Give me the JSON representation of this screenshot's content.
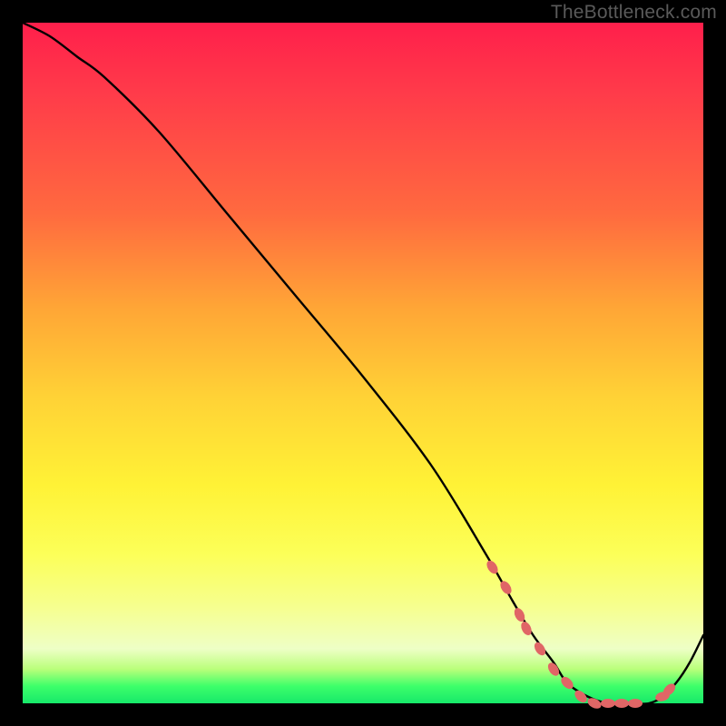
{
  "watermark": "TheBottleneck.com",
  "chart_data": {
    "type": "line",
    "title": "",
    "xlabel": "",
    "ylabel": "",
    "x_range": [
      0,
      100
    ],
    "y_range": [
      0,
      100
    ],
    "series": [
      {
        "name": "bottleneck-curve",
        "x": [
          0,
          4,
          8,
          12,
          20,
          30,
          40,
          50,
          60,
          68,
          72,
          75,
          78,
          80,
          83,
          86,
          89,
          92,
          94,
          96,
          98,
          100
        ],
        "y": [
          100,
          98,
          95,
          92,
          84,
          72,
          60,
          48,
          35,
          22,
          15,
          10,
          6,
          3,
          1,
          0,
          0,
          0,
          1,
          3,
          6,
          10
        ]
      }
    ],
    "markers": {
      "name": "highlight-dots",
      "color": "#e06666",
      "x": [
        69,
        71,
        73,
        74,
        76,
        78,
        80,
        82,
        84,
        86,
        88,
        90,
        94,
        95
      ],
      "y": [
        20,
        17,
        13,
        11,
        8,
        5,
        3,
        1,
        0,
        0,
        0,
        0,
        1,
        2
      ]
    }
  }
}
